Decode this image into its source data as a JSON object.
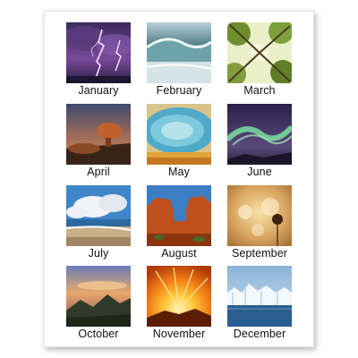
{
  "calendar": {
    "months": [
      {
        "label": "January",
        "scene": "lightning-storm"
      },
      {
        "label": "February",
        "scene": "ocean-wave"
      },
      {
        "label": "March",
        "scene": "forest-canopy"
      },
      {
        "label": "April",
        "scene": "balanced-rock-sunset"
      },
      {
        "label": "May",
        "scene": "hot-spring"
      },
      {
        "label": "June",
        "scene": "aurora"
      },
      {
        "label": "July",
        "scene": "beach-clouds"
      },
      {
        "label": "August",
        "scene": "red-rock-arch"
      },
      {
        "label": "September",
        "scene": "golden-dandelion"
      },
      {
        "label": "October",
        "scene": "mountain-sunset"
      },
      {
        "label": "November",
        "scene": "lava-eruption"
      },
      {
        "label": "December",
        "scene": "glacier"
      }
    ]
  }
}
